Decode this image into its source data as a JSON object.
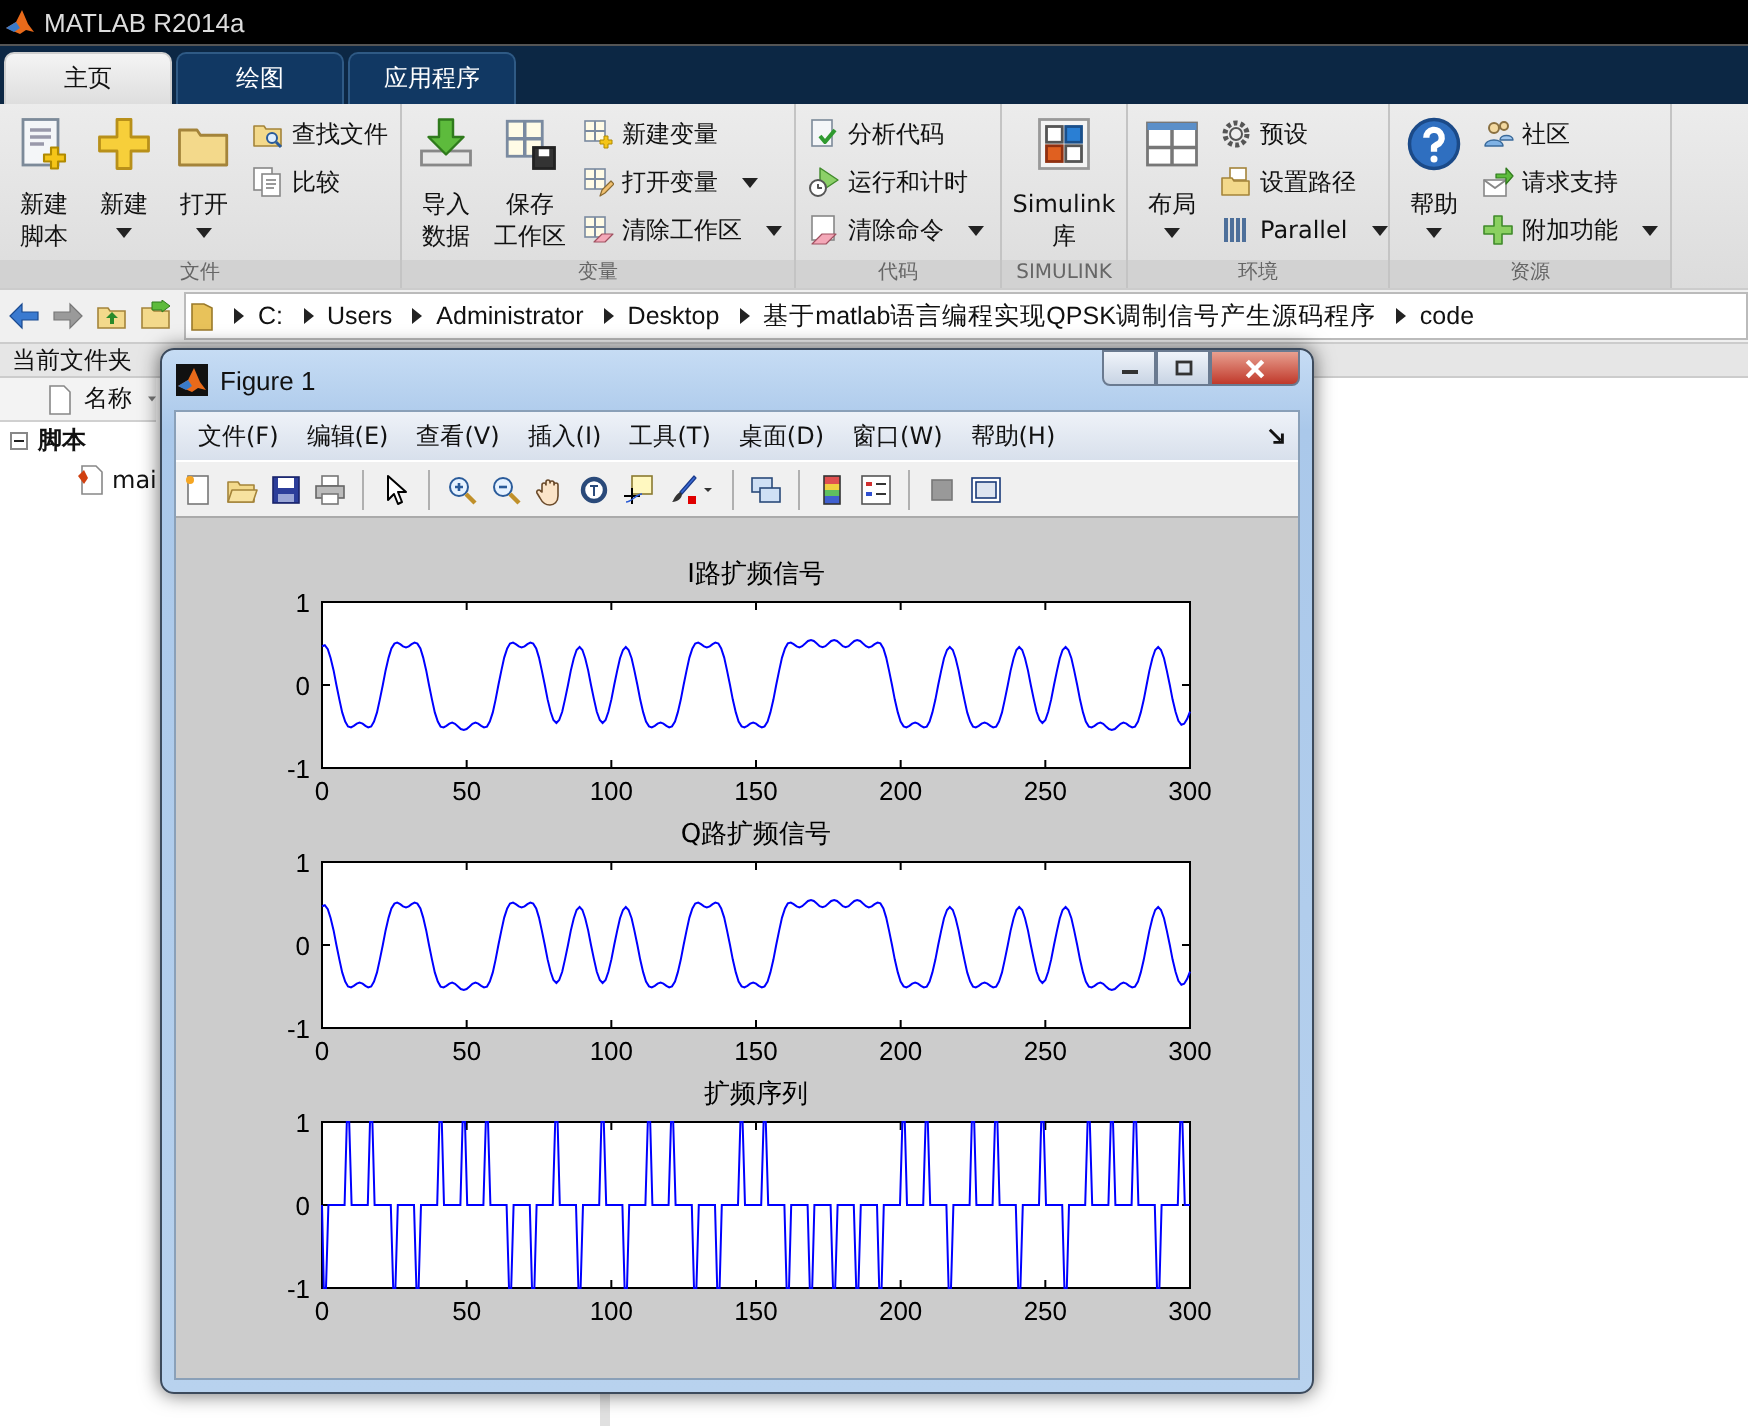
{
  "app": {
    "title": "MATLAB R2014a"
  },
  "tabs": [
    {
      "label": "主页",
      "selected": true
    },
    {
      "label": "绘图",
      "selected": false
    },
    {
      "label": "应用程序",
      "selected": false
    }
  ],
  "toolstrip": [
    {
      "label": "文件",
      "items": [
        {
          "kind": "large",
          "lines": [
            "新建",
            "脚本"
          ],
          "dropdown": false
        },
        {
          "kind": "large",
          "lines": [
            "新建"
          ],
          "dropdown": true
        },
        {
          "kind": "large",
          "lines": [
            "打开"
          ],
          "dropdown": true
        },
        {
          "kind": "small",
          "label": "查找文件",
          "dropdown": false
        },
        {
          "kind": "small",
          "label": "比较",
          "dropdown": false
        }
      ]
    },
    {
      "label": "变量",
      "items": [
        {
          "kind": "large",
          "lines": [
            "导入",
            "数据"
          ],
          "dropdown": false
        },
        {
          "kind": "large",
          "lines": [
            "保存",
            "工作区"
          ],
          "dropdown": false
        },
        {
          "kind": "small",
          "label": "新建变量",
          "dropdown": false
        },
        {
          "kind": "small",
          "label": "打开变量",
          "dropdown": true
        },
        {
          "kind": "small",
          "label": "清除工作区",
          "dropdown": true
        }
      ]
    },
    {
      "label": "代码",
      "items": [
        {
          "kind": "small",
          "label": "分析代码",
          "dropdown": false
        },
        {
          "kind": "small",
          "label": "运行和计时",
          "dropdown": false
        },
        {
          "kind": "small",
          "label": "清除命令",
          "dropdown": true
        }
      ]
    },
    {
      "label": "SIMULINK",
      "items": [
        {
          "kind": "large",
          "lines": [
            "Simulink",
            "库"
          ],
          "dropdown": false
        }
      ]
    },
    {
      "label": "环境",
      "items": [
        {
          "kind": "large",
          "lines": [
            "布局"
          ],
          "dropdown": true
        },
        {
          "kind": "small",
          "label": "预设",
          "dropdown": false
        },
        {
          "kind": "small",
          "label": "设置路径",
          "dropdown": false
        },
        {
          "kind": "small",
          "label": "Parallel",
          "dropdown": true
        }
      ]
    },
    {
      "label": "资源",
      "items": [
        {
          "kind": "large",
          "lines": [
            "帮助"
          ],
          "dropdown": true
        },
        {
          "kind": "small",
          "label": "社区",
          "dropdown": false
        },
        {
          "kind": "small",
          "label": "请求支持",
          "dropdown": false
        },
        {
          "kind": "small",
          "label": "附加功能",
          "dropdown": true
        }
      ]
    }
  ],
  "address": {
    "crumbs": [
      "C:",
      "Users",
      "Administrator",
      "Desktop",
      "基于matlab语言编程实现QPSK调制信号产生源码程序",
      "code"
    ]
  },
  "file_browser": {
    "title": "当前文件夹",
    "column": "名称",
    "tree": [
      {
        "label": "脚本",
        "expanded": true,
        "children": [
          {
            "label": "mai"
          }
        ]
      }
    ]
  },
  "figure": {
    "title": "Figure 1",
    "menu": [
      "文件(F)",
      "编辑(E)",
      "查看(V)",
      "插入(I)",
      "工具(T)",
      "桌面(D)",
      "窗口(W)",
      "帮助(H)"
    ],
    "plots": [
      {
        "title": "I路扩频信号",
        "kind": "filtered",
        "yticks": [
          "1",
          "0",
          "-1"
        ],
        "xticks": [
          "0",
          "50",
          "100",
          "150",
          "200",
          "250",
          "300"
        ]
      },
      {
        "title": "Q路扩频信号",
        "kind": "filtered",
        "yticks": [
          "1",
          "0",
          "-1"
        ],
        "xticks": [
          "0",
          "50",
          "100",
          "150",
          "200",
          "250",
          "300"
        ]
      },
      {
        "title": "扩频序列",
        "kind": "chips",
        "yticks": [
          "1",
          "0",
          "-1"
        ],
        "xticks": [
          "0",
          "50",
          "100",
          "150",
          "200",
          "250",
          "300"
        ]
      }
    ]
  }
}
